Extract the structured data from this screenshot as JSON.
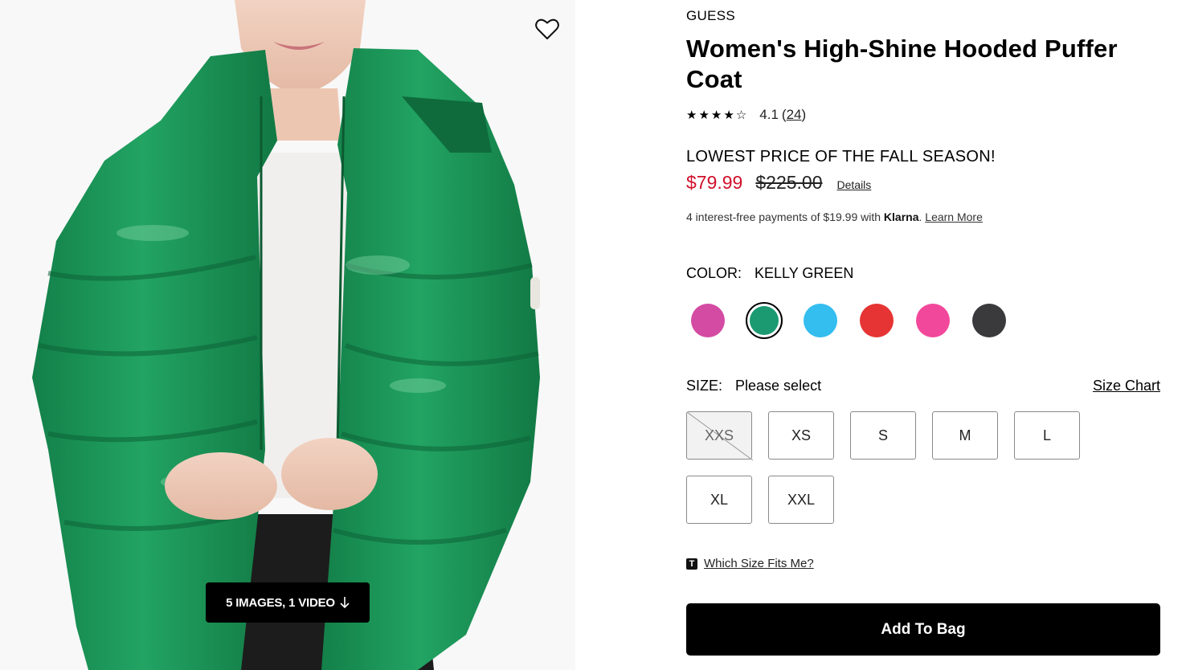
{
  "product": {
    "brand": "GUESS",
    "title": "Women's High-Shine Hooded Puffer Coat",
    "rating_value": "4.1",
    "rating_count": "24",
    "stars": [
      1,
      1,
      1,
      1,
      0
    ]
  },
  "pricing": {
    "promo": "LOWEST PRICE OF THE FALL SEASON!",
    "sale_price": "$79.99",
    "original_price": "$225.00",
    "details_label": "Details",
    "klarna_text": "4 interest-free payments of $19.99 with",
    "klarna_brand": "Klarna",
    "klarna_learn": "Learn More"
  },
  "color": {
    "label": "COLOR:",
    "selected": "KELLY GREEN",
    "swatches": [
      {
        "color": "#d44ba3",
        "selected": false
      },
      {
        "color": "#1b9a72",
        "selected": true
      },
      {
        "color": "#34bdef",
        "selected": false
      },
      {
        "color": "#e53433",
        "selected": false
      },
      {
        "color": "#f2489b",
        "selected": false
      },
      {
        "color": "#3a393c",
        "selected": false
      }
    ]
  },
  "size": {
    "label": "SIZE:",
    "placeholder": "Please select",
    "chart_label": "Size Chart",
    "options": [
      {
        "label": "XXS",
        "available": false
      },
      {
        "label": "XS",
        "available": true
      },
      {
        "label": "S",
        "available": true
      },
      {
        "label": "M",
        "available": true
      },
      {
        "label": "L",
        "available": true
      },
      {
        "label": "XL",
        "available": true
      },
      {
        "label": "XXL",
        "available": true
      }
    ],
    "fit_icon": "T",
    "fit_label": "Which Size Fits Me?"
  },
  "media": {
    "pill_label": "5 IMAGES, 1 VIDEO",
    "pill_icon": "arrow-down-icon",
    "favorite_icon": "heart-icon"
  },
  "cta": {
    "add_to_bag": "Add To Bag"
  },
  "colors": {
    "sale": "#d0112b",
    "coat": "#1f9a5e"
  }
}
